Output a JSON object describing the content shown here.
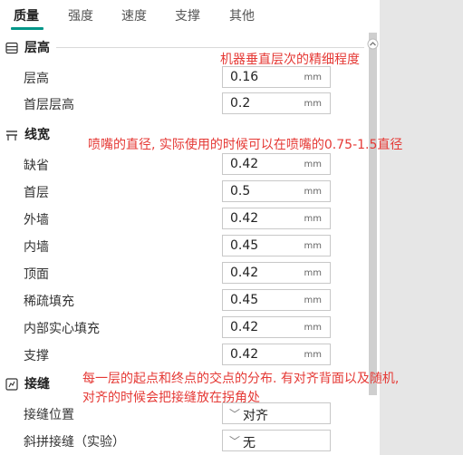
{
  "tabs": [
    {
      "label": "质量",
      "active": true
    },
    {
      "label": "强度",
      "active": false
    },
    {
      "label": "速度",
      "active": false
    },
    {
      "label": "支撑",
      "active": false
    },
    {
      "label": "其他",
      "active": false
    }
  ],
  "sections": {
    "layer_height": {
      "title": "层高",
      "rows": [
        {
          "label": "层高",
          "value": "0.16",
          "unit": "mm"
        },
        {
          "label": "首层层高",
          "value": "0.2",
          "unit": "mm"
        }
      ]
    },
    "line_width": {
      "title": "线宽",
      "rows": [
        {
          "label": "缺省",
          "value": "0.42",
          "unit": "mm"
        },
        {
          "label": "首层",
          "value": "0.5",
          "unit": "mm"
        },
        {
          "label": "外墙",
          "value": "0.42",
          "unit": "mm"
        },
        {
          "label": "内墙",
          "value": "0.45",
          "unit": "mm"
        },
        {
          "label": "顶面",
          "value": "0.42",
          "unit": "mm"
        },
        {
          "label": "稀疏填充",
          "value": "0.45",
          "unit": "mm"
        },
        {
          "label": "内部实心填充",
          "value": "0.42",
          "unit": "mm"
        },
        {
          "label": "支撑",
          "value": "0.42",
          "unit": "mm"
        }
      ]
    },
    "seam": {
      "title": "接缝",
      "rows": [
        {
          "label": "接缝位置",
          "value": "对齐"
        },
        {
          "label": "斜拼接缝（实验）",
          "value": "无"
        }
      ]
    }
  },
  "notes": {
    "layer_height": "机器垂直层次的精细程度",
    "line_width": "喷嘴的直径, 实际使用的时候可以在喷嘴的0.75-1.5直径",
    "seam_line1": "每一层的起点和终点的交点的分布. 有对齐背面以及随机,",
    "seam_line2": "对齐的时候会把接缝放在拐角处"
  },
  "colors": {
    "accent": "#009688",
    "note": "#e53935"
  },
  "icons": {
    "layer_height": "layers-icon",
    "line_width": "line-width-icon",
    "seam": "seam-icon",
    "scroll": "scroll-up-icon"
  }
}
